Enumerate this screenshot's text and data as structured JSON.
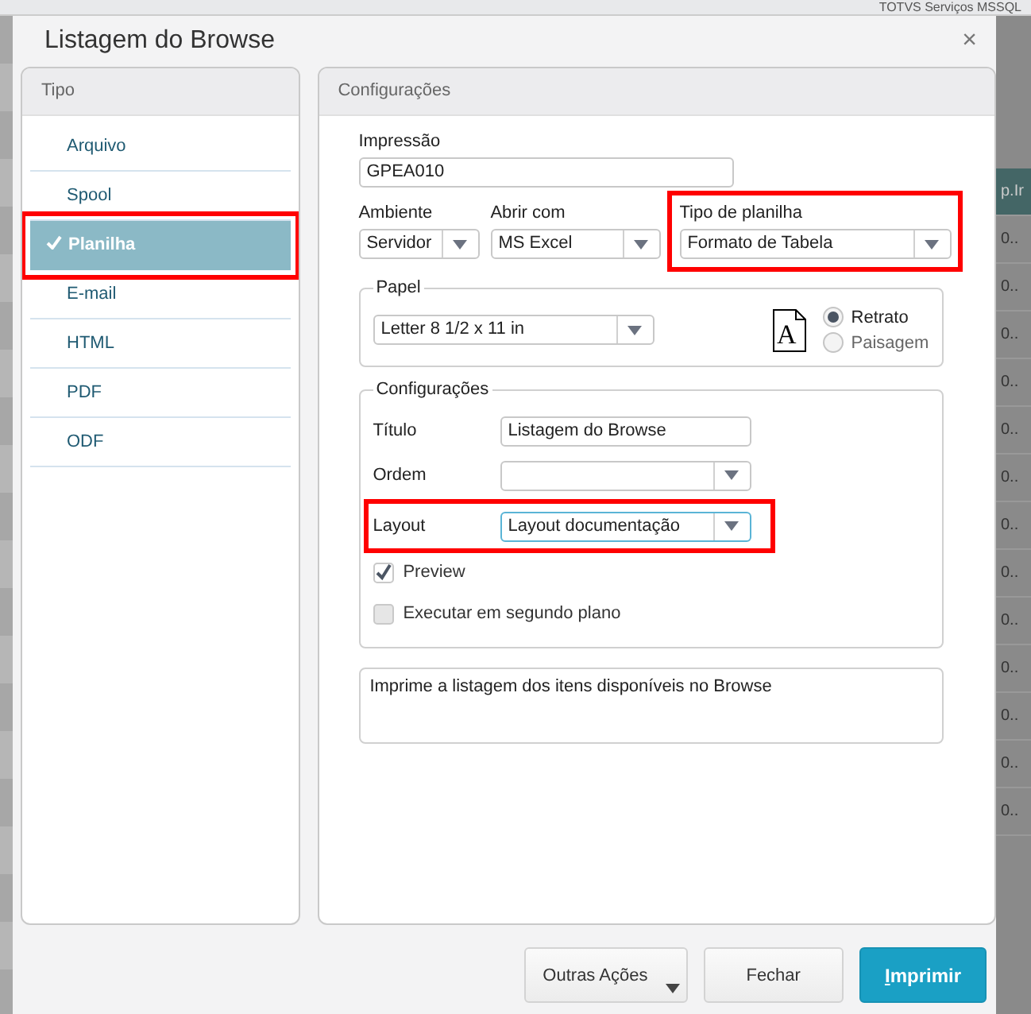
{
  "backdrop": {
    "top_bar_text": "TOTVS Serviços MSSQL",
    "side_cells": [
      "p.Ir",
      "0..",
      "0..",
      "0..",
      "0..",
      "0..",
      "0..",
      "0..",
      "0..",
      "0..",
      "0..",
      "0..",
      "0..",
      "0.."
    ]
  },
  "window": {
    "title": "Listagem do Browse",
    "close": "×"
  },
  "tipo_panel": {
    "title": "Tipo",
    "items": [
      {
        "label": "Arquivo",
        "selected": false,
        "highlighted": false
      },
      {
        "label": "Spool",
        "selected": false,
        "highlighted": false
      },
      {
        "label": "Planilha",
        "selected": true,
        "highlighted": true
      },
      {
        "label": "E-mail",
        "selected": false,
        "highlighted": false
      },
      {
        "label": "HTML",
        "selected": false,
        "highlighted": false
      },
      {
        "label": "PDF",
        "selected": false,
        "highlighted": false
      },
      {
        "label": "ODF",
        "selected": false,
        "highlighted": false
      }
    ]
  },
  "config_panel": {
    "title": "Configurações",
    "impressao": {
      "label": "Impressão",
      "value": "GPEA010"
    },
    "selects": [
      {
        "label": "Ambiente",
        "value": "Servidor",
        "highlighted": false
      },
      {
        "label": "Abrir com",
        "value": "MS Excel",
        "highlighted": false
      },
      {
        "label": "Tipo de planilha",
        "value": "Formato de Tabela",
        "highlighted": true
      }
    ],
    "papel": {
      "title": "Papel",
      "value": "Letter 8 1/2 x 11 in",
      "page_icon_letter": "A",
      "orientation": [
        {
          "label": "Retrato",
          "selected": true
        },
        {
          "label": "Paisagem",
          "selected": false
        }
      ]
    },
    "configuracoes": {
      "title": "Configurações",
      "fields": [
        {
          "label": "Título",
          "kind": "text",
          "value": "Listagem do Browse",
          "highlighted": false
        },
        {
          "label": "Ordem",
          "kind": "select",
          "highlighted": false
        },
        {
          "label": "Layout",
          "kind": "select",
          "value": "Layout documentação",
          "highlighted": true
        }
      ],
      "checkboxes": [
        {
          "label": "Preview",
          "checked": true
        },
        {
          "label": "Executar em segundo plano",
          "checked": false
        }
      ]
    },
    "description": "Imprime a listagem dos itens disponíveis no Browse"
  },
  "buttons": [
    {
      "label": "Outras Ações",
      "kind": "menu"
    },
    {
      "label": "Fechar",
      "kind": "default"
    },
    {
      "label": "Imprimir",
      "kind": "primary"
    }
  ]
}
